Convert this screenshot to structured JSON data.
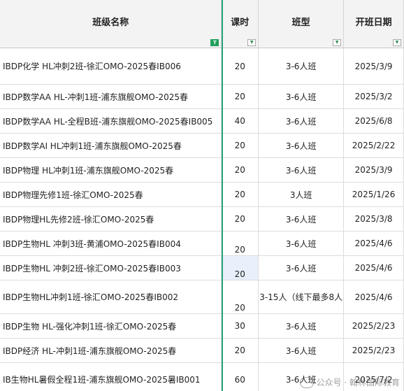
{
  "columns": [
    "班级名称",
    "课时",
    "班型",
    "开班日期"
  ],
  "filter_active_icon": "filter-active-icon",
  "filter_icon": "filter-dropdown-icon",
  "rows": [
    {
      "name": "IBDP化学 HL冲刺2班-徐汇OMO-2025春IB006",
      "hours": "20",
      "type": "3-6人班",
      "date": "2025/3/9"
    },
    {
      "name": "IBDP数学AA HL-冲刺1班-浦东旗舰OMO-2025春",
      "hours": "20",
      "type": "3-6人班",
      "date": "2025/3/2"
    },
    {
      "name": "IBDP数学AA HL-全程B班-浦东旗舰OMO-2025春IB005",
      "hours": "40",
      "type": "3-6人班",
      "date": "2025/6/8"
    },
    {
      "name": "IBDP数学AI HL冲刺1班-浦东旗舰OMO-2025春",
      "hours": "20",
      "type": "3-6人班",
      "date": "2025/2/22"
    },
    {
      "name": "IBDP物理 HL冲刺1班-浦东旗舰OMO-2025春",
      "hours": "20",
      "type": "3-6人班",
      "date": "2025/3/9"
    },
    {
      "name": "IBDP物理先修1班-徐汇OMO-2025春",
      "hours": "20",
      "type": "3人班",
      "date": "2025/1/26"
    },
    {
      "name": "IBDP物理HL先修2班-徐汇OMO-2025春",
      "hours": "20",
      "type": "3-6人班",
      "date": "2025/3/8"
    },
    {
      "name": "IBDP生物HL 冲刺3班-黄浦OMO-2025春IB004",
      "hours": "20",
      "type": "3-6人班",
      "date": "2025/4/6"
    },
    {
      "name": "IBDP生物HL 冲刺2班-徐汇OMO-2025春IB003",
      "hours": "20",
      "type": "3-6人班",
      "date": "2025/4/6"
    },
    {
      "name": "IBDP生物HL冲刺1班-徐汇OMO-2025春IB002",
      "hours": "20",
      "type": "3-15人（线下最多8人",
      "date": "2025/4/6"
    },
    {
      "name": "IBDP生物 HL-强化冲刺1班-徐汇OMO-2025春",
      "hours": "30",
      "type": "3-6人班",
      "date": "2025/2/23"
    },
    {
      "name": "IBDP经济 HL-冲刺1班-浦东旗舰OMO-2025春",
      "hours": "20",
      "type": "3-6人班",
      "date": "2025/2/23"
    },
    {
      "name": "IB生物HL暑假全程1班-浦东旗舰OMO-2025暑IB001",
      "hours": "60",
      "type": "3-6人班",
      "date": "2025/7/2"
    }
  ],
  "watermark": "公众号 · 翰林国际教育"
}
